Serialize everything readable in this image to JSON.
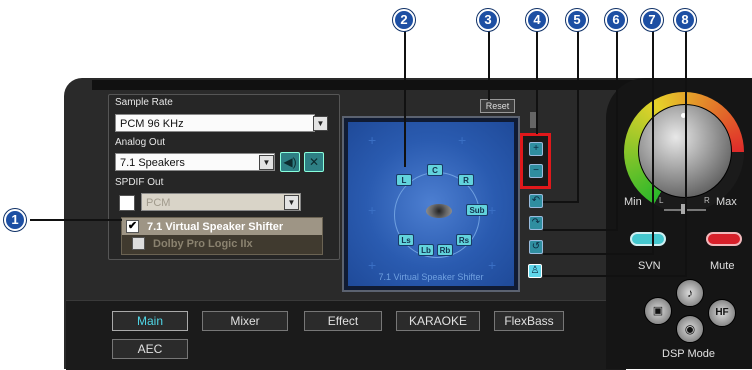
{
  "callouts": [
    "1",
    "2",
    "3",
    "4",
    "5",
    "6",
    "7",
    "8"
  ],
  "settings": {
    "sample_rate_label": "Sample Rate",
    "sample_rate_value": "PCM 96 KHz",
    "analog_out_label": "Analog Out",
    "analog_out_value": "7.1 Speakers",
    "spdif_label": "SPDIF  Out",
    "spdif_value": "PCM"
  },
  "options": [
    {
      "label": "7.1 Virtual Speaker Shifter",
      "checked": true
    },
    {
      "label": "Dolby Pro Logic IIx",
      "checked": false
    }
  ],
  "stage": {
    "caption": "7.1 Virtual Speaker Shifter",
    "speakers": [
      "L",
      "C",
      "R",
      "Sub",
      "Ls",
      "Lb",
      "Rb",
      "Rs"
    ]
  },
  "controls": {
    "reset_label": "Reset",
    "plus": "+",
    "minus": "−"
  },
  "knob": {
    "min_label": "Min",
    "max_label": "Max",
    "l_label": "L",
    "r_label": "R"
  },
  "buttons": {
    "svn_label": "SVN",
    "mute_label": "Mute",
    "dsp_label": "DSP Mode"
  },
  "tabs": [
    "Main",
    "Mixer",
    "Effect",
    "KARAOKE",
    "FlexBass",
    "AEC"
  ],
  "colors": {
    "accent": "#2f8ea0",
    "active_tab": "#4fd6e6",
    "highlight": "#e0181b",
    "callout": "#1d4fa3"
  }
}
